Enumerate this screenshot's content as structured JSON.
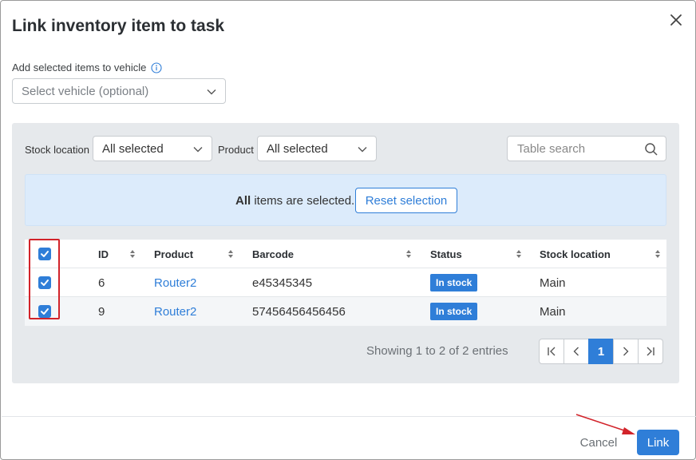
{
  "dialog": {
    "title": "Link inventory item to task"
  },
  "vehicle": {
    "label": "Add selected items to vehicle",
    "placeholder": "Select vehicle (optional)"
  },
  "filters": {
    "stock_location_label": "Stock location",
    "stock_location_value": "All selected",
    "product_label": "Product",
    "product_value": "All selected",
    "search_placeholder": "Table search"
  },
  "banner": {
    "bold": "All",
    "text": " items are selected.",
    "reset_label": "Reset selection"
  },
  "table": {
    "columns": [
      "ID",
      "Product",
      "Barcode",
      "Status",
      "Stock location"
    ],
    "rows": [
      {
        "id": "6",
        "product": "Router2",
        "barcode": "e45345345",
        "status": "In stock",
        "location": "Main",
        "checked": true
      },
      {
        "id": "9",
        "product": "Router2",
        "barcode": "57456456456456",
        "status": "In stock",
        "location": "Main",
        "checked": true
      }
    ],
    "header_checked": true
  },
  "pagination": {
    "summary": "Showing 1 to 2 of 2 entries",
    "current_page": "1"
  },
  "footer": {
    "cancel_label": "Cancel",
    "link_label": "Link"
  },
  "colors": {
    "accent": "#2f7ed8",
    "annotation": "#d2232a",
    "panel_bg": "#e6e9ec",
    "banner_bg": "#dcebfb"
  },
  "icons": {
    "close": "close-icon",
    "info": "info-icon",
    "chevron": "chevron-down-icon",
    "search": "search-icon",
    "sort": "sort-icon",
    "check": "check-icon"
  }
}
